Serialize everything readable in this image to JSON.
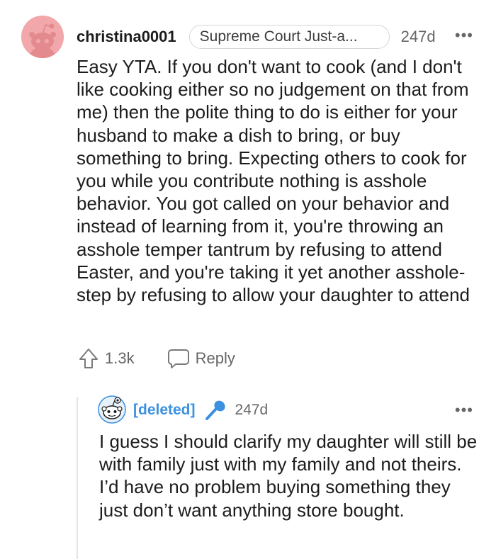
{
  "comment": {
    "username": "christina0001",
    "flair": "Supreme Court Just-a...",
    "time": "247d",
    "more": "•••",
    "body": "Easy YTA. If you don't want to cook (and I don't like cooking either so no judgement on that from me) then the polite thing to do is either for your husband to make a dish to bring, or buy something to bring. Expecting others to cook for you while you contribute nothing is asshole behavior. You got called on your behavior and instead of learning from it, you're throwing an asshole temper tantrum by refusing to attend Easter, and you're taking it yet another asshole-step by refusing to allow your daughter to attend",
    "upvotes": "1.3k",
    "reply_label": "Reply",
    "icons": {
      "avatar": "reddit-avatar-icon",
      "upvote": "upvote-arrow-icon",
      "reply": "speech-bubble-icon"
    }
  },
  "reply": {
    "username": "[deleted]",
    "time": "247d",
    "more": "•••",
    "body": "I guess I should clarify my daughter will still be with family just with my family and not theirs. I’d have no problem buying something they just don’t want anything store bought.",
    "icons": {
      "avatar": "reddit-avatar-icon",
      "op_badge": "microphone-icon"
    }
  },
  "colors": {
    "avatar_bg": "#f2a7aa",
    "deleted_blue": "#3b90e0",
    "meta_gray": "#666666"
  }
}
